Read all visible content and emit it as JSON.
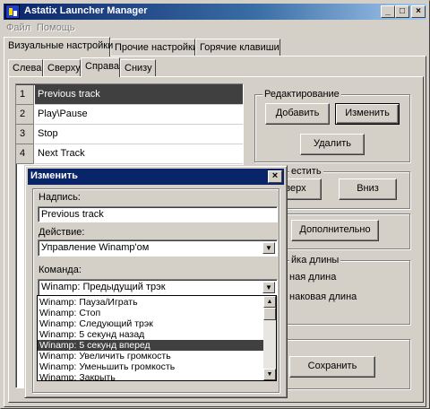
{
  "app": {
    "title": "Astatix Launcher Manager"
  },
  "window_buttons": {
    "minimize": "_",
    "maximize": "□",
    "close": "×"
  },
  "menu": [
    {
      "label": "Файл"
    },
    {
      "label": "Помощь"
    }
  ],
  "main_tabs": [
    {
      "label": "Визуальные настройки"
    },
    {
      "label": "Прочие настройки"
    },
    {
      "label": "Горячие клавиши"
    }
  ],
  "sub_tabs": [
    {
      "label": "Слева"
    },
    {
      "label": "Сверху"
    },
    {
      "label": "Справа"
    },
    {
      "label": "Снизу"
    }
  ],
  "list": [
    {
      "num": "1",
      "label": "Previous track"
    },
    {
      "num": "2",
      "label": "Play\\Pause"
    },
    {
      "num": "3",
      "label": "Stop"
    },
    {
      "num": "4",
      "label": "Next Track"
    }
  ],
  "edit_group": {
    "legend": "Редактирование",
    "add_label": "Добавить",
    "change_label": "Изменить",
    "delete_label": "Удалить"
  },
  "move_group": {
    "legend": "естить",
    "up_label": "верх",
    "down_label": "Вниз"
  },
  "extra_button": "Дополнительно",
  "length_group": {
    "legend": "йка длины",
    "option1": "ная длина",
    "option2": "наковая длина"
  },
  "save_label": "Сохранить",
  "dialog": {
    "title": "Изменить",
    "close": "×",
    "caption_label": "Надпись:",
    "caption_value": "Previous track",
    "action_label": "Действие:",
    "action_value": "Управление Winamp'ом",
    "command_label": "Команда:",
    "command_value": "Winamp: Предыдущий трэк",
    "dropdown_arrow": "▼",
    "command_options": [
      "Winamp: Пауза/Играть",
      "Winamp: Стоп",
      "Winamp: Следующий трэк",
      "Winamp: 5 секунд назад",
      "Winamp: 5 секунд вперед",
      "Winamp: Увеличить громкость",
      "Winamp: Уменьшить громкость",
      "Winamp: Закрыть"
    ],
    "selected_option": "Winamp: 5 секунд вперед",
    "scroll_up": "▲",
    "scroll_down": "▼"
  }
}
